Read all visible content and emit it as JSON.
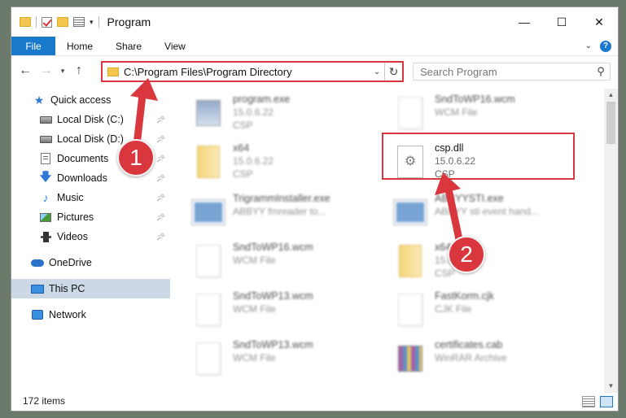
{
  "window": {
    "title": "Program",
    "controls": {
      "minimize": "—",
      "maximize": "☐",
      "close": "✕"
    }
  },
  "ribbon": {
    "tabs": [
      "File",
      "Home",
      "Share",
      "View"
    ],
    "help": "?"
  },
  "nav": {
    "back": "←",
    "forward": "→",
    "up": "↑",
    "address": "C:\\Program Files\\Program Directory",
    "search_placeholder": "Search Program"
  },
  "sidebar": {
    "items": [
      {
        "label": "Quick access",
        "icon": "star-icon"
      },
      {
        "label": "Local Disk (C:)",
        "icon": "drive-icon",
        "pinned": true
      },
      {
        "label": "Local Disk (D:)",
        "icon": "drive-icon",
        "pinned": true
      },
      {
        "label": "Documents",
        "icon": "document-icon",
        "pinned": true
      },
      {
        "label": "Downloads",
        "icon": "download-icon",
        "pinned": true
      },
      {
        "label": "Music",
        "icon": "music-icon",
        "pinned": true
      },
      {
        "label": "Pictures",
        "icon": "pictures-icon",
        "pinned": true
      },
      {
        "label": "Videos",
        "icon": "videos-icon",
        "pinned": true
      },
      {
        "label": "OneDrive",
        "icon": "cloud-icon"
      },
      {
        "label": "This PC",
        "icon": "computer-icon",
        "selected": true
      },
      {
        "label": "Network",
        "icon": "network-icon"
      }
    ]
  },
  "files": [
    {
      "name": "program.exe",
      "line2": "15.0.6.22",
      "line3": "CSP",
      "type": "exe"
    },
    {
      "name": "SndToWP16.wcm",
      "line2": "WCM File",
      "line3": "",
      "type": "page"
    },
    {
      "name": "x64",
      "line2": "15.0.6.22",
      "line3": "CSP",
      "type": "folder"
    },
    {
      "name": "csp.dll",
      "line2": "15.0.6.22",
      "line3": "CSP",
      "type": "dll"
    },
    {
      "name": "TrigrammInstaller.exe",
      "line2": "ABBYY fmreader to...",
      "line3": "",
      "type": "app"
    },
    {
      "name": "ABBYYSTI.exe",
      "line2": "ABBYY sti event hand...",
      "line3": "",
      "type": "app"
    },
    {
      "name": "SndToWP16.wcm",
      "line2": "WCM File",
      "line3": "",
      "type": "page"
    },
    {
      "name": "x64",
      "line2": "15.0.6.22",
      "line3": "CSP",
      "type": "folder"
    },
    {
      "name": "SndToWP13.wcm",
      "line2": "WCM File",
      "line3": "",
      "type": "page"
    },
    {
      "name": "FastKorm.cjk",
      "line2": "CJK File",
      "line3": "",
      "type": "page"
    },
    {
      "name": "SndToWP13.wcm",
      "line2": "WCM File",
      "line3": "",
      "type": "page"
    },
    {
      "name": "certificates.cab",
      "line2": "WinRAR Archive",
      "line3": "",
      "type": "cab"
    }
  ],
  "status": {
    "count": "172 items"
  },
  "annotations": {
    "step1": "1",
    "step2": "2"
  }
}
